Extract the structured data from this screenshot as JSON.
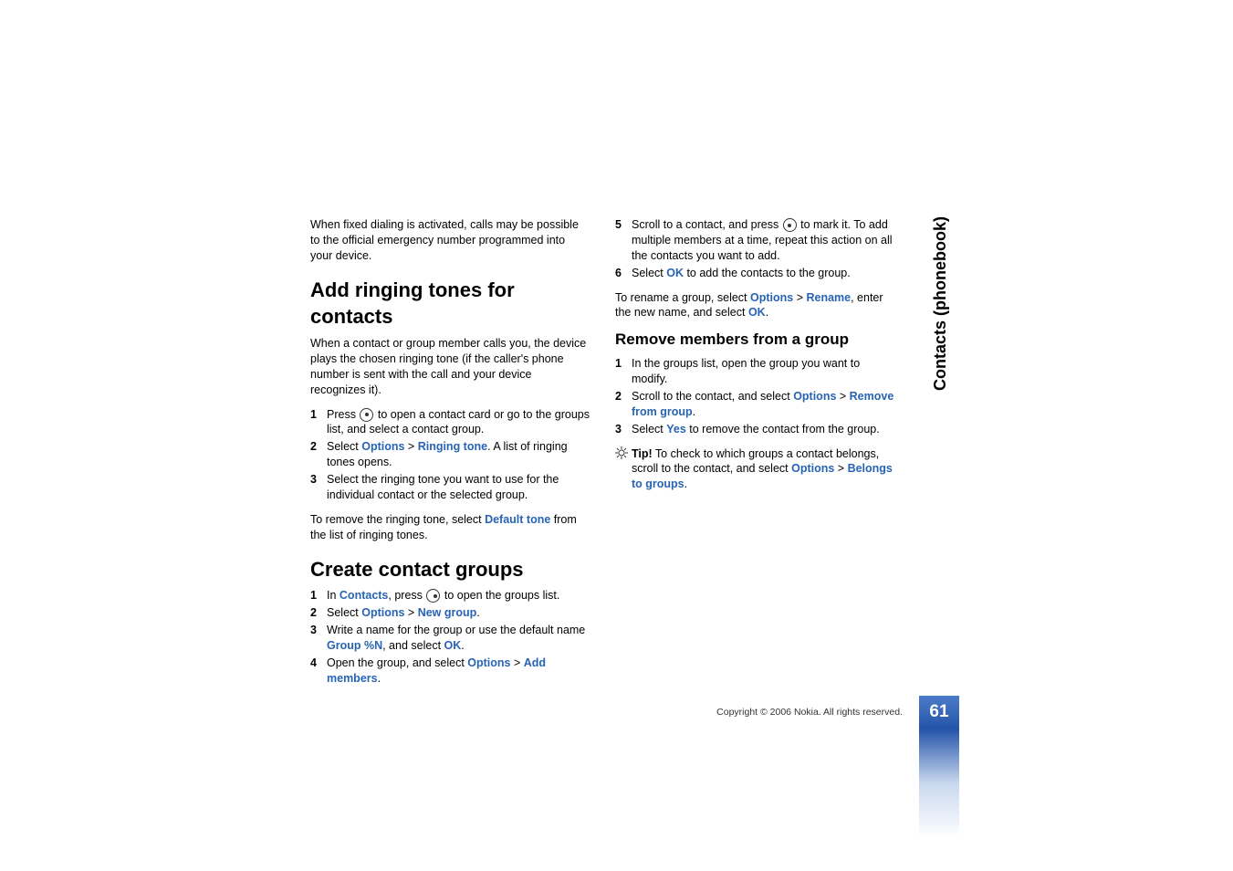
{
  "sideLabel": "Contacts (phonebook)",
  "col1": {
    "intro": "When fixed dialing is activated, calls may be possible to the official emergency number programmed into your device.",
    "h2a": "Add ringing tones for contacts",
    "p2": "When a contact or group member calls you, the device plays the chosen ringing tone (if the caller's phone number is sent with the call and your device recognizes it).",
    "li1a": "Press ",
    "li1b": " to open a contact card or go to the groups list, and select a contact group.",
    "li2a": "Select ",
    "li2opt": "Options",
    "li2gt": " > ",
    "li2rt": "Ringing tone",
    "li2b": ". A list of ringing tones opens.",
    "li3": "Select the ringing tone you want to use for the individual contact or the selected group.",
    "p3a": "To remove the ringing tone, select ",
    "p3def": "Default tone",
    "p3b": " from the list of ringing tones.",
    "h2b": "Create contact groups",
    "lic1a": "In ",
    "lic1cont": "Contacts",
    "lic1b": ", press ",
    "lic1c": " to open the groups list.",
    "lic2a": "Select ",
    "lic2opt": "Options",
    "lic2gt": " > ",
    "lic2ng": "New group",
    "lic2b": ".",
    "lic3a": "Write a name for the group or use the default name ",
    "lic3grp": "Group %N",
    "lic3b": ", and select ",
    "lic3ok": "OK",
    "lic3c": ".",
    "lic4a": "Open the group, and select ",
    "lic4opt": "Options",
    "lic4gt": " > ",
    "lic4am": "Add members",
    "lic4b": "."
  },
  "col2": {
    "li5a": "Scroll to a contact, and press ",
    "li5b": " to mark it. To add multiple members at a time, repeat this action on all the contacts you want to add.",
    "li6a": "Select ",
    "li6ok": "OK",
    "li6b": " to add the contacts to the group.",
    "p1a": "To rename a group, select ",
    "p1opt": "Options",
    "p1gt": " > ",
    "p1ren": "Rename",
    "p1b": ", enter the new name, and select ",
    "p1ok": "OK",
    "p1c": ".",
    "h3": "Remove members from a group",
    "r1": "In the groups list, open the group you want to modify.",
    "r2a": "Scroll to the contact, and select ",
    "r2opt": "Options",
    "r2gt": " > ",
    "r2rem": "Remove from group",
    "r2b": ".",
    "r3a": "Select ",
    "r3yes": "Yes",
    "r3b": " to remove the contact from the group.",
    "tipLabel": "Tip!",
    "tipa": " To check to which groups a contact belongs, scroll to the contact, and select ",
    "tipopt": "Options",
    "tipgt": " > ",
    "tipbel": "Belongs to groups",
    "tipb": "."
  },
  "footer": {
    "copyright": "Copyright © 2006 Nokia. All rights reserved.",
    "pageNum": "61"
  },
  "nums": {
    "n1": "1",
    "n2": "2",
    "n3": "3",
    "n4": "4",
    "n5": "5",
    "n6": "6"
  }
}
